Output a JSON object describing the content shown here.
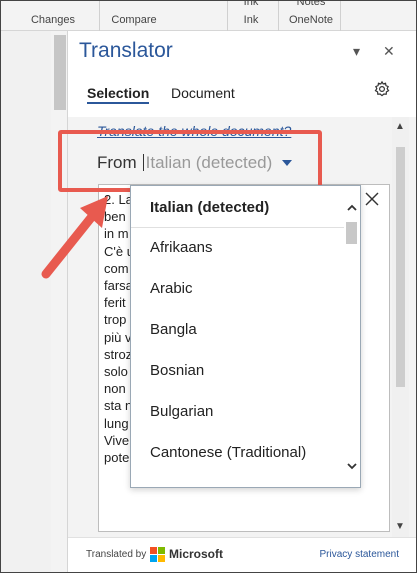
{
  "ribbon": {
    "groups": [
      {
        "top": "",
        "label": "Changes"
      },
      {
        "top": "",
        "label": "Compare"
      },
      {
        "top": "Ink",
        "label": "Ink"
      },
      {
        "top": "Notes",
        "label": "OneNote"
      }
    ]
  },
  "pane": {
    "title": "Translator",
    "pin_symbol": "▾",
    "close_symbol": "✕",
    "tabs": [
      {
        "label": "Selection",
        "active": true
      },
      {
        "label": "Document",
        "active": false
      }
    ],
    "link_text": "Translate the whole document?",
    "from_label": "From",
    "from_value": "Italian (detected)"
  },
  "source_text_lines": [
    "2. La",
    "ben",
    "in m",
    "C'è u",
    "com",
    "farsa",
    "ferit",
    "trop",
    "più v",
    "strozz",
    "solo",
    "non",
    "sta n",
    "lung",
    "Vive",
    "pote"
  ],
  "dropdown": {
    "selected": "Italian (detected)",
    "items": [
      "Afrikaans",
      "Arabic",
      "Bangla",
      "Bosnian",
      "Bulgarian",
      "Cantonese (Traditional)"
    ]
  },
  "footer": {
    "translated_by": "Translated by",
    "brand": "Microsoft",
    "privacy": "Privacy statement"
  },
  "colors": {
    "accent": "#2b579a",
    "highlight": "#e85a4f"
  }
}
